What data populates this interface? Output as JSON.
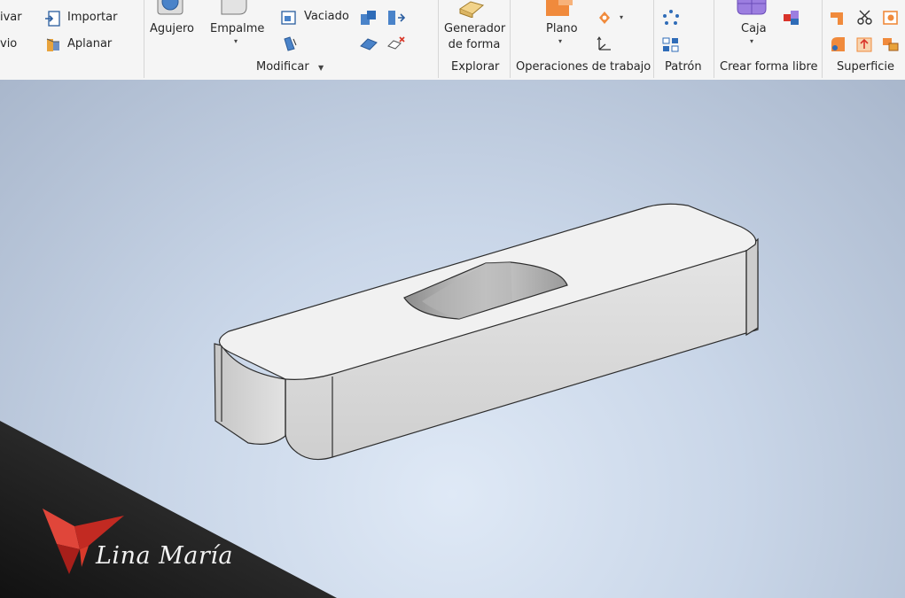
{
  "ribbon": {
    "create": {
      "cut_left_top": "ivar",
      "cut_left_bottom": "vio",
      "import_label": "Importar",
      "flatten_label": "Aplanar"
    },
    "modify": {
      "hole_label": "Agujero",
      "fillet_label": "Empalme",
      "shell_label": "Vaciado",
      "group_label": "Modificar"
    },
    "explore": {
      "shape_generator_label": "Generador\nde forma",
      "group_label": "Explorar"
    },
    "work_features": {
      "plane_label": "Plano",
      "group_label": "Operaciones de trabajo"
    },
    "pattern": {
      "group_label": "Patrón"
    },
    "freeform": {
      "box_label": "Caja",
      "group_label": "Crear forma libre"
    },
    "surface": {
      "group_label": "Superficie"
    }
  },
  "watermark": {
    "text": "Lina María"
  },
  "colors": {
    "viewport_top": "#a9b7cc",
    "viewport_bottom": "#dfe9f6",
    "part_top": "#f3f3f3",
    "part_side": "#d9d9d9",
    "brand_red": "#d9342b"
  }
}
